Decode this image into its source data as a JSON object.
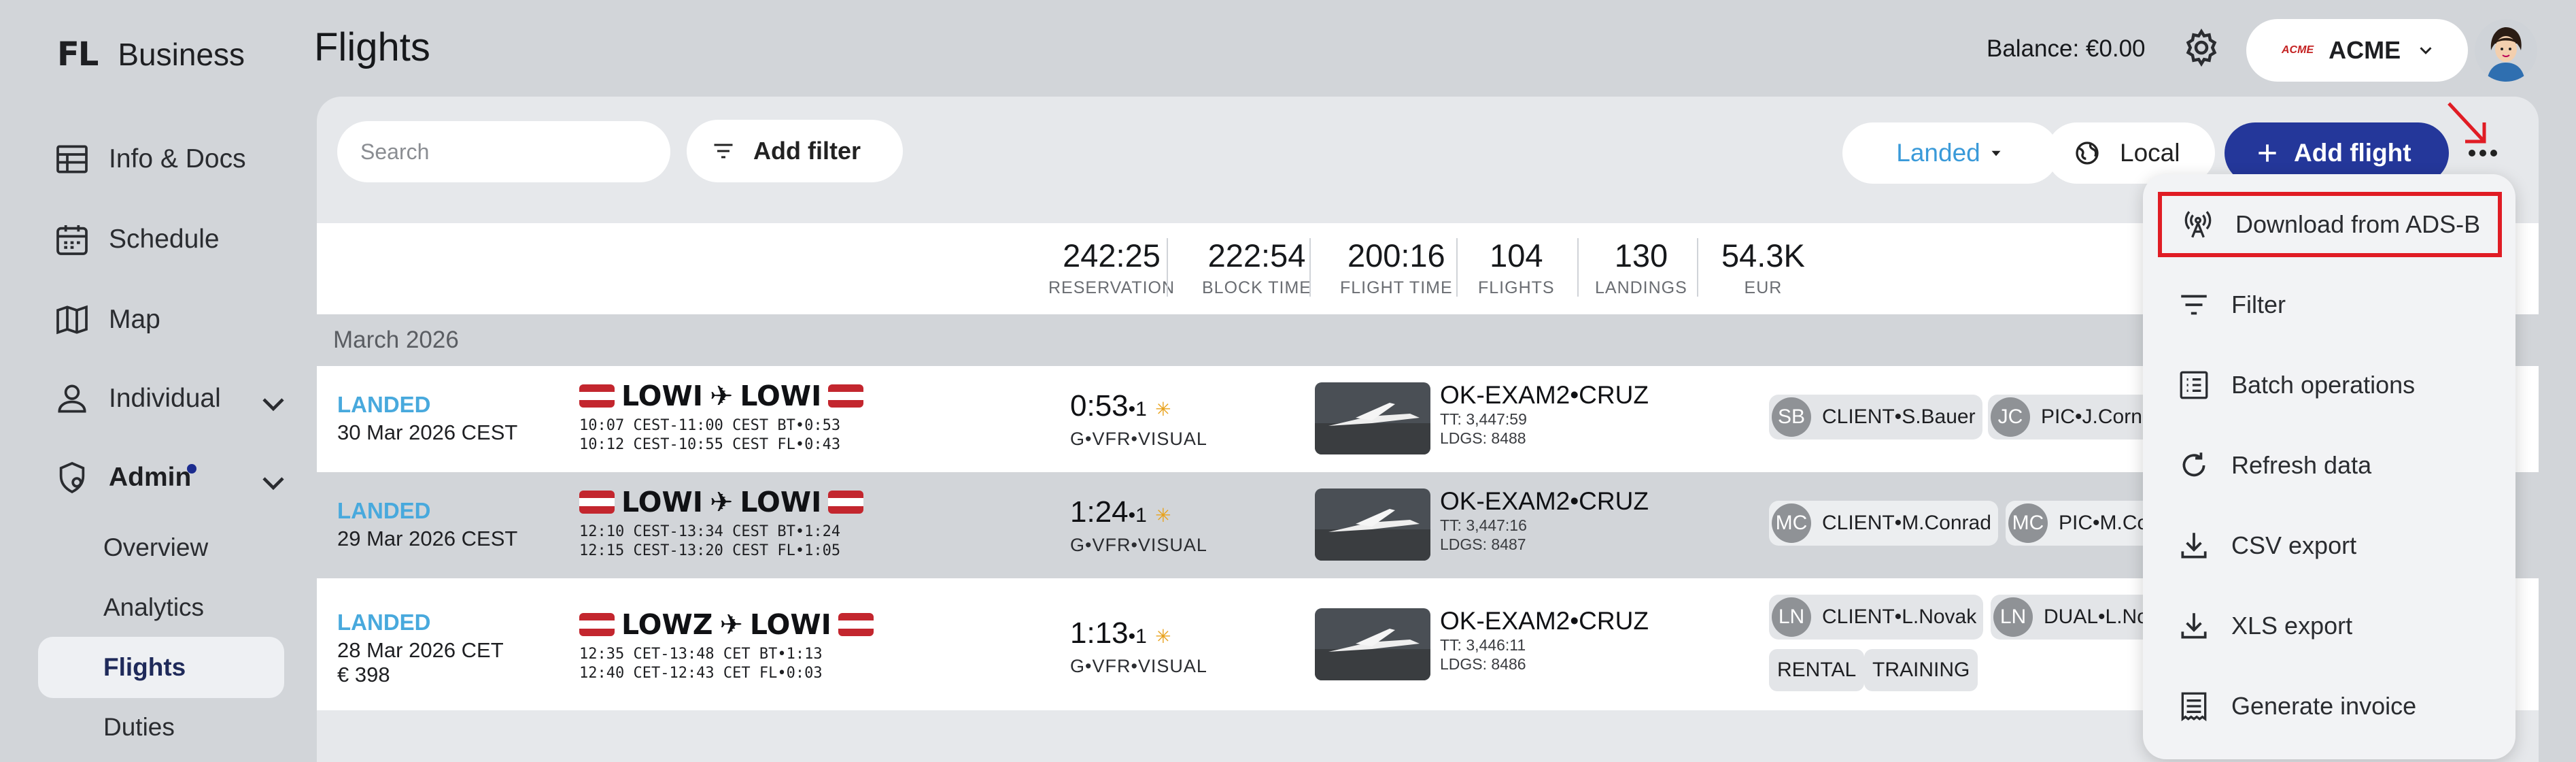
{
  "sidebar": {
    "logo_mark": "FL",
    "logo_text": "Business",
    "items": [
      {
        "label": "Info & Docs"
      },
      {
        "label": "Schedule"
      },
      {
        "label": "Map"
      },
      {
        "label": "Individual"
      },
      {
        "label": "Admin"
      }
    ],
    "sub_items": [
      {
        "label": "Overview"
      },
      {
        "label": "Analytics"
      },
      {
        "label": "Flights"
      },
      {
        "label": "Duties"
      }
    ]
  },
  "header": {
    "title": "Flights",
    "balance": "Balance: €0.00",
    "org_logo": "ACME",
    "org_name": "ACME"
  },
  "toolbar": {
    "search_placeholder": "Search",
    "add_filter": "Add filter",
    "status_filter": "Landed",
    "timezone": "Local",
    "add_flight": "Add flight"
  },
  "stats": [
    {
      "value": "242:25",
      "label": "RESERVATION"
    },
    {
      "value": "222:54",
      "label": "BLOCK TIME"
    },
    {
      "value": "200:16",
      "label": "FLIGHT TIME"
    },
    {
      "value": "104",
      "label": "FLIGHTS"
    },
    {
      "value": "130",
      "label": "LANDINGS"
    },
    {
      "value": "54.3K",
      "label": "EUR"
    }
  ],
  "month": "March 2026",
  "flights": [
    {
      "status": "LANDED",
      "date": "30 Mar 2026 CEST",
      "price": "",
      "from": "LOWI",
      "to": "LOWI",
      "times_1": "10:07 CEST-11:00 CEST BT•0:53",
      "times_2": "10:12 CEST-10:55 CEST FL•0:43",
      "duration": "0:53",
      "landings": "•1",
      "rules": "G•VFR•VISUAL",
      "aircraft": "OK-EXAM2•CRUZ",
      "tt": "TT: 3,447:59",
      "ldgs": "LDGS: 8488",
      "crew": [
        {
          "initials": "SB",
          "label": "CLIENT•S.Bauer"
        },
        {
          "initials": "JC",
          "label": "PIC•J.Corne"
        }
      ],
      "tags": []
    },
    {
      "status": "LANDED",
      "date": "29 Mar 2026 CEST",
      "price": "",
      "from": "LOWI",
      "to": "LOWI",
      "times_1": "12:10 CEST-13:34 CEST BT•1:24",
      "times_2": "12:15 CEST-13:20 CEST FL•1:05",
      "duration": "1:24",
      "landings": "•1",
      "rules": "G•VFR•VISUAL",
      "aircraft": "OK-EXAM2•CRUZ",
      "tt": "TT: 3,447:16",
      "ldgs": "LDGS: 8487",
      "crew": [
        {
          "initials": "MC",
          "label": "CLIENT•M.Conrad"
        },
        {
          "initials": "MC",
          "label": "PIC•M.Co"
        }
      ],
      "tags": []
    },
    {
      "status": "LANDED",
      "date": "28 Mar 2026 CET",
      "price": "€ 398",
      "from": "LOWZ",
      "to": "LOWI",
      "times_1": "12:35 CET-13:48 CET BT•1:13",
      "times_2": "12:40 CET-12:43 CET FL•0:03",
      "duration": "1:13",
      "landings": "•1",
      "rules": "G•VFR•VISUAL",
      "aircraft": "OK-EXAM2•CRUZ",
      "tt": "TT: 3,446:11",
      "ldgs": "LDGS: 8486",
      "crew": [
        {
          "initials": "LN",
          "label": "CLIENT•L.Novak"
        },
        {
          "initials": "LN",
          "label": "DUAL•L.No"
        }
      ],
      "tags": [
        "RENTAL",
        "TRAINING"
      ]
    }
  ],
  "menu": [
    {
      "label": "Download from ADS-B",
      "icon": "antenna-icon"
    },
    {
      "label": "Filter",
      "icon": "filter-icon"
    },
    {
      "label": "Batch operations",
      "icon": "list-icon"
    },
    {
      "label": "Refresh data",
      "icon": "refresh-icon"
    },
    {
      "label": "CSV export",
      "icon": "download-icon"
    },
    {
      "label": "XLS export",
      "icon": "download-icon"
    },
    {
      "label": "Generate invoice",
      "icon": "invoice-icon"
    }
  ],
  "colors": {
    "accent": "#24379a",
    "status_landed": "#48a9dd",
    "highlight": "#e01c24"
  }
}
